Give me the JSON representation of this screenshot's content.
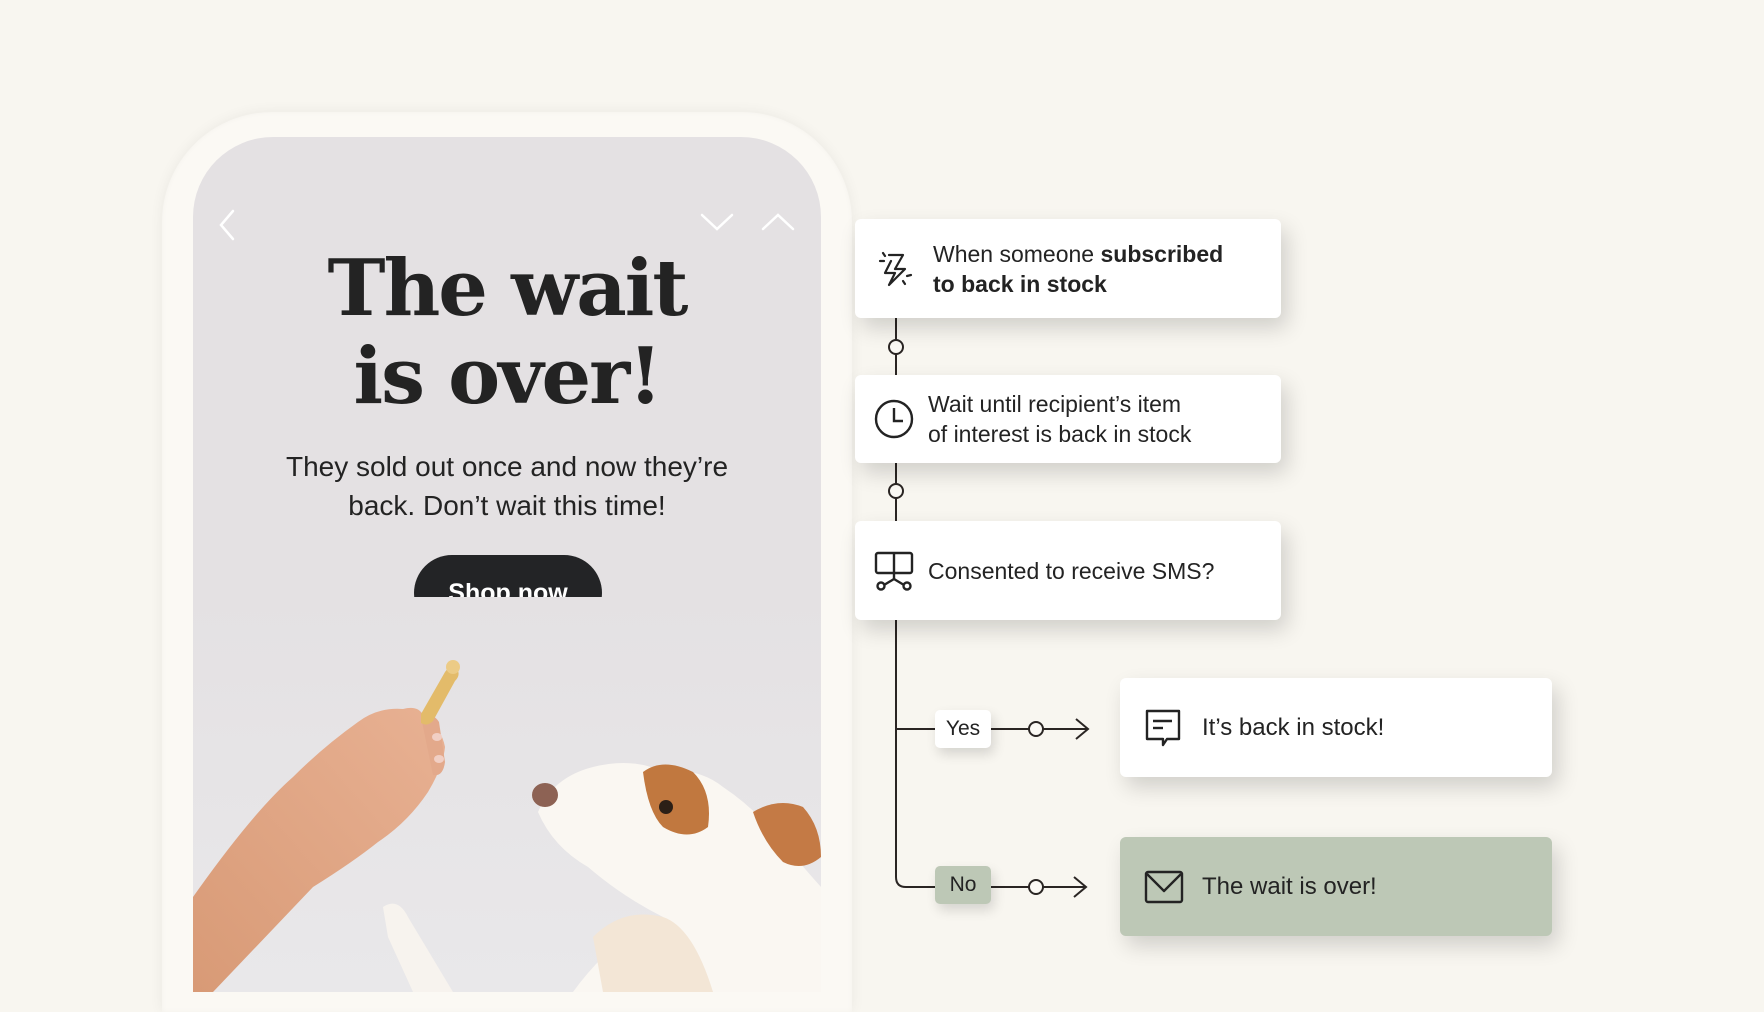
{
  "phone": {
    "nav": {
      "back_icon": "chevron-left-icon",
      "down_icon": "chevron-down-icon",
      "up_icon": "chevron-up-icon"
    },
    "headline_line1": "The wait",
    "headline_line2": "is over!",
    "subtext_line1": "They sold out once and now they’re",
    "subtext_line2": "back. Don’t wait this time!",
    "cta_label": "Shop now",
    "photo_alt": "Hand offering a bone-shaped treat to a white and brown dog"
  },
  "flow": {
    "trigger": {
      "icon": "lightning-bolt-icon",
      "text_regular": "When someone ",
      "text_bold_1": "subscribed",
      "text_bold_2": "to back in stock"
    },
    "wait": {
      "icon": "clock-icon",
      "line1": "Wait until recipient’s item",
      "line2": "of interest is back in stock"
    },
    "split": {
      "icon": "split-branch-icon",
      "text": "Consented to receive SMS?"
    },
    "branches": [
      {
        "label": "Yes",
        "icon": "sms-message-icon",
        "action": "It’s back in stock!",
        "color": "#ffffff"
      },
      {
        "label": "No",
        "icon": "email-envelope-icon",
        "action": "The wait is over!",
        "color": "#bdc8b6"
      }
    ]
  },
  "colors": {
    "background": "#f8f6f0",
    "screen": "#e4e1e3",
    "button": "#232426",
    "sage": "#bdc8b6",
    "line": "#2a2523"
  }
}
